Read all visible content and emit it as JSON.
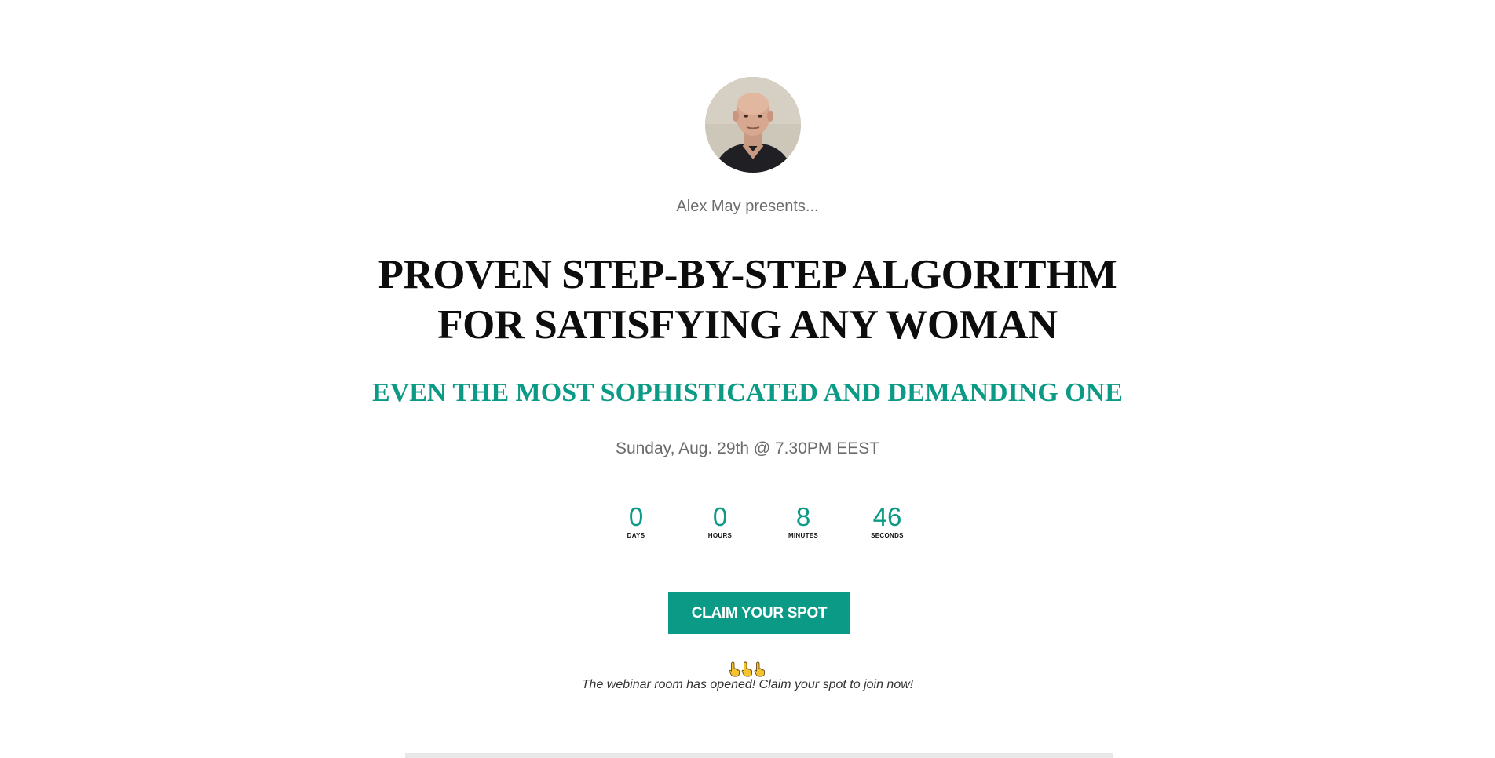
{
  "presenter": {
    "avatar_icon": "presenter-avatar-photo",
    "text": "Alex May presents..."
  },
  "headline": {
    "line1": "PROVEN STEP-BY-STEP ALGORITHM",
    "line2": "FOR SATISFYING ANY WOMAN"
  },
  "subheadline": "EVEN THE MOST SOPHISTICATED AND DEMANDING ONE",
  "event": {
    "datetime": "Sunday, Aug. 29th @ 7.30PM EEST"
  },
  "countdown": {
    "days": {
      "value": "0",
      "label": "DAYS"
    },
    "hours": {
      "value": "0",
      "label": "HOURS"
    },
    "minutes": {
      "value": "8",
      "label": "MINUTES"
    },
    "seconds": {
      "value": "46",
      "label": "SECONDS"
    }
  },
  "cta": {
    "label": "CLAIM YOUR SPOT"
  },
  "notice": {
    "icons": [
      "pointing-hand-icon",
      "pointing-hand-icon",
      "pointing-hand-icon"
    ],
    "text": "The webinar room has opened! Claim your spot to join now!"
  },
  "colors": {
    "accent": "#0a9a85",
    "muted_text": "#6b6b6b",
    "headline": "#0d0d0d"
  }
}
